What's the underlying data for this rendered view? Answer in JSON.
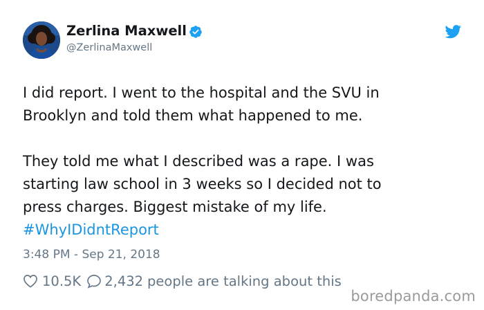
{
  "author": {
    "display_name": "Zerlina Maxwell",
    "handle": "@ZerlinaMaxwell",
    "verified": true
  },
  "tweet": {
    "paragraphs": [
      [
        "I did report. I went to the hospital and the SVU in",
        "Brooklyn and told them what happened to me."
      ],
      [
        "They told me what I described was a rape. I was",
        "starting law school in 3 weeks so I decided not to",
        "press charges. Biggest mistake of my life."
      ]
    ],
    "hashtag": "#WhyIDidntReport",
    "timestamp": "3:48 PM - Sep 21, 2018"
  },
  "actions": {
    "like_count": "10.5K",
    "reply_count": "2,432",
    "talking_text": "people are talking about this"
  },
  "watermark": "boredpanda.com",
  "icons": {
    "verified": "verified-badge-icon",
    "brand": "twitter-bird-icon",
    "like": "heart-icon",
    "reply": "speech-bubble-icon"
  },
  "colors": {
    "text": "#14171a",
    "secondary": "#657786",
    "link": "#1b95e0",
    "brand": "#1da1f2",
    "watermark": "#9a9a9a"
  }
}
